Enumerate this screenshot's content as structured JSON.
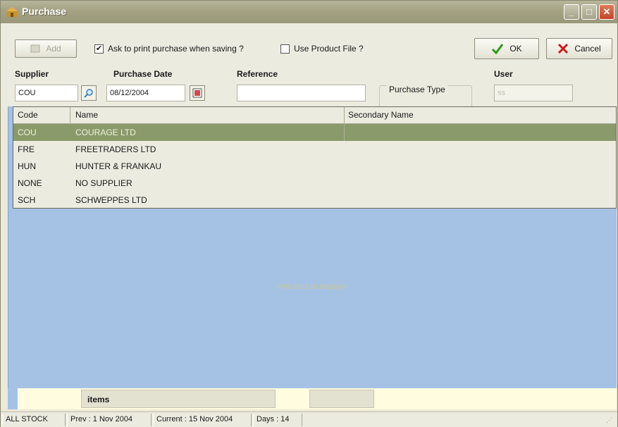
{
  "window": {
    "title": "Purchase"
  },
  "toolbar": {
    "add_label": "Add",
    "ask_print_label": "Ask to print purchase when saving ?",
    "ask_print_checked": true,
    "use_product_label": "Use Product File ?",
    "use_product_checked": false,
    "ok_label": "OK",
    "cancel_label": "Cancel"
  },
  "header": {
    "supplier_label": "Supplier",
    "supplier_value": "COU",
    "date_label": "Purchase Date",
    "date_value": "08/12/2004",
    "reference_label": "Reference",
    "reference_value": "",
    "purchase_type_label": "Purchase Type",
    "user_label": "User",
    "user_value": "ss"
  },
  "supplier_grid": {
    "columns": [
      "Code",
      "Name",
      "Secondary Name"
    ],
    "rows": [
      {
        "code": "COU",
        "name": "COURAGE LTD",
        "secondary": "",
        "selected": true
      },
      {
        "code": "FRE",
        "name": "FREETRADERS LTD",
        "secondary": ""
      },
      {
        "code": "HUN",
        "name": "HUNTER & FRANKAU",
        "secondary": ""
      },
      {
        "code": "NONE",
        "name": "NO SUPPLIER",
        "secondary": ""
      },
      {
        "code": "SCH",
        "name": "SCHWEPPES LTD",
        "secondary": ""
      }
    ]
  },
  "main": {
    "empty_text": "<No data to display>"
  },
  "footer": {
    "items_label": "items"
  },
  "statusbar": {
    "stock": "ALL STOCK",
    "prev": "Prev : 1 Nov 2004",
    "current": "Current : 15 Nov 2004",
    "days": "Days : 14"
  },
  "colors": {
    "selected_row": "#8a9a6a",
    "main_bg": "#a5c2e5",
    "ok_check": "#2a9a1a",
    "cancel_x": "#cc1a1a"
  }
}
